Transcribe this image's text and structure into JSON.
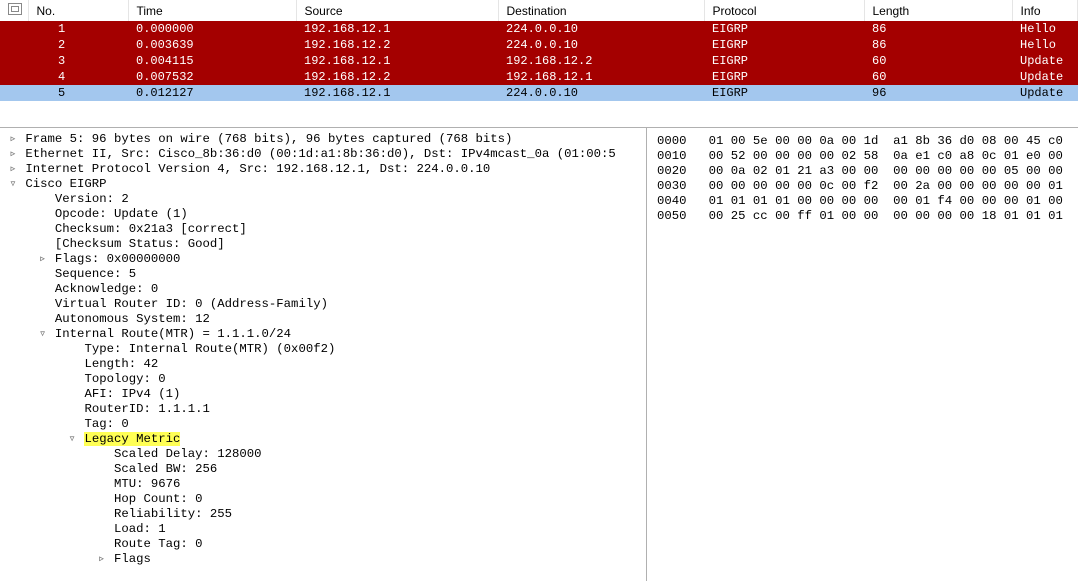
{
  "columns": {
    "no": "No.",
    "time": "Time",
    "source": "Source",
    "destination": "Destination",
    "protocol": "Protocol",
    "length": "Length",
    "info": "Info"
  },
  "packets": [
    {
      "no": "1",
      "time": "0.000000",
      "src": "192.168.12.1",
      "dst": "224.0.0.10",
      "proto": "EIGRP",
      "len": "86",
      "info": "Hello",
      "cls": "red-row"
    },
    {
      "no": "2",
      "time": "0.003639",
      "src": "192.168.12.2",
      "dst": "224.0.0.10",
      "proto": "EIGRP",
      "len": "86",
      "info": "Hello",
      "cls": "red-row"
    },
    {
      "no": "3",
      "time": "0.004115",
      "src": "192.168.12.1",
      "dst": "192.168.12.2",
      "proto": "EIGRP",
      "len": "60",
      "info": "Update",
      "cls": "red-row"
    },
    {
      "no": "4",
      "time": "0.007532",
      "src": "192.168.12.2",
      "dst": "192.168.12.1",
      "proto": "EIGRP",
      "len": "60",
      "info": "Update",
      "cls": "red-row"
    },
    {
      "no": "5",
      "time": "0.012127",
      "src": "192.168.12.1",
      "dst": "224.0.0.10",
      "proto": "EIGRP",
      "len": "96",
      "info": "Update",
      "cls": "sel-row"
    }
  ],
  "details": [
    {
      "indent": 0,
      "toggle": "▹",
      "text": "Frame 5: 96 bytes on wire (768 bits), 96 bytes captured (768 bits)"
    },
    {
      "indent": 0,
      "toggle": "▹",
      "text": "Ethernet II, Src: Cisco_8b:36:d0 (00:1d:a1:8b:36:d0), Dst: IPv4mcast_0a (01:00:5"
    },
    {
      "indent": 0,
      "toggle": "▹",
      "text": "Internet Protocol Version 4, Src: 192.168.12.1, Dst: 224.0.0.10"
    },
    {
      "indent": 0,
      "toggle": "▿",
      "text": "Cisco EIGRP"
    },
    {
      "indent": 1,
      "toggle": " ",
      "text": "Version: 2"
    },
    {
      "indent": 1,
      "toggle": " ",
      "text": "Opcode: Update (1)"
    },
    {
      "indent": 1,
      "toggle": " ",
      "text": "Checksum: 0x21a3 [correct]"
    },
    {
      "indent": 1,
      "toggle": " ",
      "text": "[Checksum Status: Good]"
    },
    {
      "indent": 1,
      "toggle": "▹",
      "text": "Flags: 0x00000000"
    },
    {
      "indent": 1,
      "toggle": " ",
      "text": "Sequence: 5"
    },
    {
      "indent": 1,
      "toggle": " ",
      "text": "Acknowledge: 0"
    },
    {
      "indent": 1,
      "toggle": " ",
      "text": "Virtual Router ID: 0 (Address-Family)"
    },
    {
      "indent": 1,
      "toggle": " ",
      "text": "Autonomous System: 12"
    },
    {
      "indent": 1,
      "toggle": "▿",
      "text": "Internal Route(MTR) = 1.1.1.0/24"
    },
    {
      "indent": 2,
      "toggle": " ",
      "text": "Type: Internal Route(MTR) (0x00f2)"
    },
    {
      "indent": 2,
      "toggle": " ",
      "text": "Length: 42"
    },
    {
      "indent": 2,
      "toggle": " ",
      "text": "Topology: 0"
    },
    {
      "indent": 2,
      "toggle": " ",
      "text": "AFI: IPv4 (1)"
    },
    {
      "indent": 2,
      "toggle": " ",
      "text": "RouterID: 1.1.1.1"
    },
    {
      "indent": 2,
      "toggle": " ",
      "text": "Tag: 0"
    },
    {
      "indent": 2,
      "toggle": "▿",
      "text": "Legacy Metric",
      "hl": true
    },
    {
      "indent": 3,
      "toggle": " ",
      "text": "Scaled Delay: 128000"
    },
    {
      "indent": 3,
      "toggle": " ",
      "text": "Scaled BW: 256"
    },
    {
      "indent": 3,
      "toggle": " ",
      "text": "MTU: 9676"
    },
    {
      "indent": 3,
      "toggle": " ",
      "text": "Hop Count: 0"
    },
    {
      "indent": 3,
      "toggle": " ",
      "text": "Reliability: 255"
    },
    {
      "indent": 3,
      "toggle": " ",
      "text": "Load: 1"
    },
    {
      "indent": 3,
      "toggle": " ",
      "text": "Route Tag: 0"
    },
    {
      "indent": 3,
      "toggle": "▹",
      "text": "Flags"
    }
  ],
  "hex": [
    {
      "off": "0000",
      "b1": "01 00 5e 00 00 0a 00 1d",
      "b2": "a1 8b 36 d0 08 00 45 c0"
    },
    {
      "off": "0010",
      "b1": "00 52 00 00 00 00 02 58",
      "b2": "0a e1 c0 a8 0c 01 e0 00"
    },
    {
      "off": "0020",
      "b1": "00 0a 02 01 21 a3 00 00",
      "b2": "00 00 00 00 00 05 00 00"
    },
    {
      "off": "0030",
      "b1": "00 00 00 00 00 0c 00 f2",
      "b2": "00 2a 00 00 00 00 00 01"
    },
    {
      "off": "0040",
      "b1": "01 01 01 01 00 00 00 00",
      "b2": "00 01 f4 00 00 00 01 00"
    },
    {
      "off": "0050",
      "b1": "00 25 cc 00 ff 01 00 00",
      "b2": "00 00 00 00 18 01 01 01"
    }
  ]
}
